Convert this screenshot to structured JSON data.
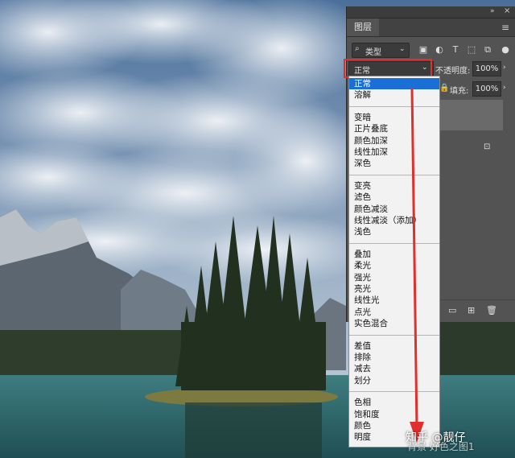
{
  "layers_panel": {
    "tab_title": "图层",
    "filter": {
      "label": "类型",
      "icon": "search-icon"
    },
    "filter_buttons": [
      "image-filter-icon",
      "adjustment-filter-icon",
      "type-filter-icon",
      "shape-filter-icon",
      "smart-object-filter-icon"
    ],
    "blend_mode_current": "正常",
    "opacity_label": "不透明度:",
    "opacity_value": "100%",
    "fill_label": "填充:",
    "fill_value": "100%"
  },
  "blend_menu": {
    "groups": [
      [
        "正常",
        "溶解"
      ],
      [
        "变暗",
        "正片叠底",
        "颜色加深",
        "线性加深",
        "深色"
      ],
      [
        "变亮",
        "滤色",
        "颜色减淡",
        "线性减淡（添加）",
        "浅色"
      ],
      [
        "叠加",
        "柔光",
        "强光",
        "亮光",
        "线性光",
        "点光",
        "实色混合"
      ],
      [
        "差值",
        "排除",
        "减去",
        "划分"
      ],
      [
        "色相",
        "饱和度",
        "颜色",
        "明度"
      ]
    ],
    "selected": "正常"
  },
  "watermark": {
    "line1": "知乎 @靓仔",
    "line2": "背景  好色之图1"
  },
  "colors": {
    "highlight_red": "#e0302e",
    "selection_blue": "#1a6fd6",
    "panel_gray": "#535353"
  }
}
